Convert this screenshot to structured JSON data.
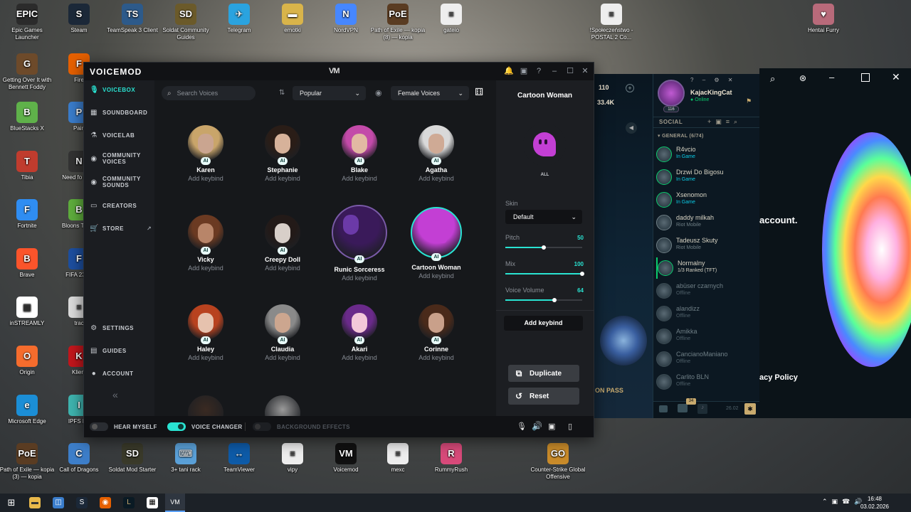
{
  "desktop_icons_top": [
    {
      "label": "Epic Games Launcher",
      "color": "#2b2b2b",
      "glyph": "EPIC"
    },
    {
      "label": "Steam",
      "color": "#1b2838",
      "glyph": "S"
    },
    {
      "label": "TeamSpeak 3 Client",
      "color": "#2d5a8a",
      "glyph": "TS"
    },
    {
      "label": "Soldat Community Guides",
      "color": "#6b5a2a",
      "glyph": "SD"
    },
    {
      "label": "Telegram",
      "color": "#2aa3df",
      "glyph": "✈"
    },
    {
      "label": "emotki",
      "color": "#d9b44a",
      "glyph": "▬"
    },
    {
      "label": "NordVPN",
      "color": "#4687ff",
      "glyph": "N"
    },
    {
      "label": "Path of Exile — kopia (8) — kopia",
      "color": "#5a3c22",
      "glyph": "PoE"
    },
    {
      "label": "gateio",
      "color": "#eeeeee",
      "glyph": "≡"
    },
    {
      "label": "!Społeczeństwo - POSTAL 2 Co...",
      "color": "#eeeeee",
      "glyph": "≡"
    },
    {
      "label": "Hentai Furry",
      "color": "#b86a7a",
      "glyph": "♥"
    }
  ],
  "desktop_icons_left": [
    {
      "label": "Getting Over It with Bennett Foddy",
      "color": "#6d4a2a",
      "glyph": "G"
    },
    {
      "label": "BlueStacks X",
      "color": "#5fb14a",
      "glyph": "B"
    },
    {
      "label": "Tibia",
      "color": "#c03c2e",
      "glyph": "T"
    },
    {
      "label": "Fortnite",
      "color": "#2f8df2",
      "glyph": "F"
    },
    {
      "label": "Brave",
      "color": "#fb542b",
      "glyph": "B"
    },
    {
      "label": "inSTREAMLY",
      "color": "#ffffff",
      "glyph": "▦"
    },
    {
      "label": "Origin",
      "color": "#f56c2d",
      "glyph": "O"
    },
    {
      "label": "Microsoft Edge",
      "color": "#1b8ed6",
      "glyph": "e"
    },
    {
      "label": "Path of Exile — kopia (3) — kopia",
      "color": "#5a3c22",
      "glyph": "PoE"
    }
  ],
  "desktop_icons_left2": [
    {
      "label": "Fire",
      "color": "#e66000",
      "glyph": "F"
    },
    {
      "label": "Pain",
      "color": "#3a7dcc",
      "glyph": "P"
    },
    {
      "label": "Need fo Carb",
      "color": "#333",
      "glyph": "N"
    },
    {
      "label": "Bloons T kopi",
      "color": "#5fae3d",
      "glyph": "B"
    },
    {
      "label": "FIFA 23 —",
      "color": "#1d4fa0",
      "glyph": "F"
    },
    {
      "label": "trac",
      "color": "#ddd",
      "glyph": "≡"
    },
    {
      "label": "Klient",
      "color": "#c3161c",
      "glyph": "K"
    },
    {
      "label": "IPFS De",
      "color": "#3fb5b0",
      "glyph": "I"
    }
  ],
  "desktop_icons_bottom": [
    {
      "label": "Call of Dragons",
      "color": "#3d7ec9",
      "glyph": "C"
    },
    {
      "label": "Soldat Mod Starter",
      "color": "#3a3a2a",
      "glyph": "SD"
    },
    {
      "label": "3+ tani rack",
      "color": "#5aa0d8",
      "glyph": "⌨"
    },
    {
      "label": "TeamViewer",
      "color": "#0e5ba8",
      "glyph": "↔"
    },
    {
      "label": "vipy",
      "color": "#eeeeee",
      "glyph": "≡"
    },
    {
      "label": "Voicemod",
      "color": "#111111",
      "glyph": "VM"
    },
    {
      "label": "mexc",
      "color": "#eeeeee",
      "glyph": "≡"
    },
    {
      "label": "RummyRush",
      "color": "#d84a7a",
      "glyph": "R"
    },
    {
      "label": "Counter-Strike Global Offensive",
      "color": "#c98b2a",
      "glyph": "GO"
    }
  ],
  "voicemod": {
    "logo": "VOICEMOD",
    "mark": "VM",
    "accent": "#29e3d2",
    "nav": [
      {
        "label": "VOICEBOX",
        "icon": "🎙",
        "active": true
      },
      {
        "label": "SOUNDBOARD",
        "icon": "▦",
        "active": false
      },
      {
        "label": "VOICELAB",
        "icon": "⚗",
        "active": false
      },
      {
        "label": "COMMUNITY VOICES",
        "icon": "◉",
        "active": false
      },
      {
        "label": "COMMUNITY SOUNDS",
        "icon": "◉",
        "active": false
      },
      {
        "label": "CREATORS",
        "icon": "▭",
        "active": false
      },
      {
        "label": "STORE",
        "icon": "🛒",
        "active": false
      }
    ],
    "nav_bottom": [
      {
        "label": "SETTINGS",
        "icon": "⚙"
      },
      {
        "label": "GUIDES",
        "icon": "▤"
      },
      {
        "label": "ACCOUNT",
        "icon": "●"
      }
    ],
    "collapse": "«",
    "search_placeholder": "Search Voices",
    "sort_value": "Popular",
    "filter_value": "Female Voices",
    "ai_badge": "AI",
    "voices": [
      {
        "name": "Karen",
        "keybind": "Add keybind",
        "face": "#caa590",
        "hair": "#c9a56a"
      },
      {
        "name": "Stephanie",
        "keybind": "Add keybind",
        "face": "#d7b29a",
        "hair": "#2a1d17"
      },
      {
        "name": "Blake",
        "keybind": "Add keybind",
        "face": "#e2b9a3",
        "hair": "#c34aa9"
      },
      {
        "name": "Agatha",
        "keybind": "Add keybind",
        "face": "#cfaa95",
        "hair": "#d9d9d9"
      },
      {
        "name": "Vicky",
        "keybind": "Add keybind",
        "face": "#b88569",
        "hair": "#6b3a22"
      },
      {
        "name": "Creepy Doll",
        "keybind": "Add keybind",
        "face": "#d8cfc9",
        "hair": "#231a18"
      },
      {
        "name": "Runic Sorceress",
        "keybind": "Add keybind",
        "face": "#6b3aa8",
        "hair": "#3a1a5a"
      },
      {
        "name": "Cartoon Woman",
        "keybind": "Add keybind",
        "face": "#262a30",
        "hair": "#c33fd4"
      },
      {
        "name": "Haley",
        "keybind": "Add keybind",
        "face": "#e6c2ae",
        "hair": "#b8421f"
      },
      {
        "name": "Claudia",
        "keybind": "Add keybind",
        "face": "#cca68f",
        "hair": "#8a8a8a"
      },
      {
        "name": "Akari",
        "keybind": "Add keybind",
        "face": "#f3c8d9",
        "hair": "#6a2a8a"
      },
      {
        "name": "Corinne",
        "keybind": "Add keybind",
        "face": "#c9a08a",
        "hair": "#4a2a1a"
      }
    ],
    "selected": {
      "title": "Cartoon Woman",
      "tag": "ALL",
      "skin_label": "Skin",
      "skin_value": "Default",
      "sliders": [
        {
          "label": "Pitch",
          "value": "50",
          "fraction": 0.5
        },
        {
          "label": "Mix",
          "value": "100",
          "fraction": 1.0
        },
        {
          "label": "Voice Volume",
          "value": "64",
          "fraction": 0.64
        }
      ],
      "add_keybind": "Add keybind",
      "duplicate": "Duplicate",
      "reset": "Reset"
    },
    "bottom": {
      "hear_myself": "HEAR MYSELF",
      "voice_changer": "VOICE CHANGER",
      "background_effects": "BACKGROUND EFFECTS"
    }
  },
  "lol": {
    "level_counter": "110",
    "currency": "33.4K",
    "username": "KajacKingCat",
    "status": "Online",
    "level": "116",
    "social": "SOCIAL",
    "group": "GENERAL (6/74)",
    "friends": [
      {
        "name": "R4vcio",
        "status": "In Game",
        "state": "game"
      },
      {
        "name": "Drzwi Do Bigosu",
        "status": "In Game",
        "state": "game"
      },
      {
        "name": "Xsenomon",
        "status": "In Game",
        "state": "game"
      },
      {
        "name": "daddy milkah",
        "status": "Riot Mobile",
        "state": "mob"
      },
      {
        "name": "Tadeusz Skuty",
        "status": "Riot Mobile",
        "state": "mob"
      },
      {
        "name": "Normalny",
        "status": "1/3 Ranked (TFT)",
        "state": "tft"
      },
      {
        "name": "abüser czarnych",
        "status": "Offline",
        "state": "off"
      },
      {
        "name": "alandizz",
        "status": "Offline",
        "state": "off"
      },
      {
        "name": "Amikka",
        "status": "Offline",
        "state": "off"
      },
      {
        "name": "CancianoManiano",
        "status": "Offline",
        "state": "off"
      },
      {
        "name": "Carlito BLN",
        "status": "Offline",
        "state": "off"
      }
    ],
    "chat_badge": "34",
    "pass_label": "ON PASS",
    "time_hint": "26.02"
  },
  "right_window": {
    "account_text": "account.",
    "privacy_text": "acy Policy"
  },
  "taskbar": {
    "time": "16:48",
    "date": "03.02.2026"
  }
}
